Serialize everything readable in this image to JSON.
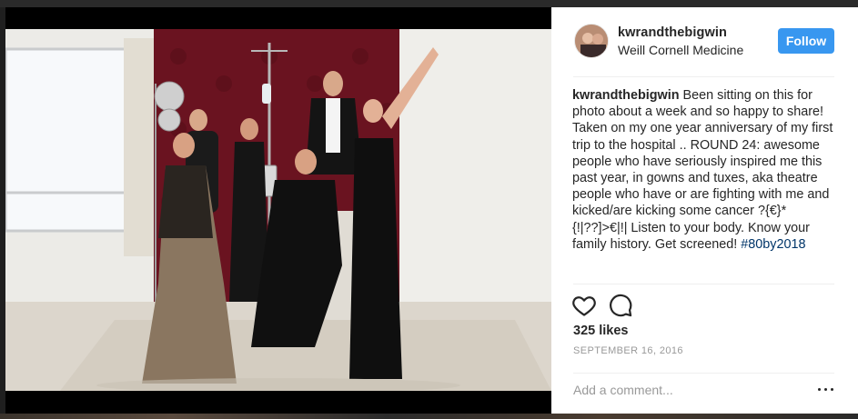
{
  "post": {
    "author": {
      "username": "kwrandthebigwin",
      "location": "Weill Cornell Medicine",
      "avatar_icon": "profile-photo-icon"
    },
    "follow_label": "Follow",
    "caption": {
      "username": "kwrandthebigwin",
      "text": " Been sitting on this for photo about a week and so happy to share! Taken on my one year anniversary of my first trip to the hospital .. ROUND 24: awesome people who have seriously inspired me this past year, in gowns and tuxes, aka theatre people who have or are fighting with me and kicked/are kicking some cancer ?{€}*{!|??]>€|!| Listen to your body. Know your family history. Get screened! ",
      "hashtag": "#80by2018"
    },
    "likes": "325 likes",
    "date": "SEPTEMBER 16, 2016",
    "comment_placeholder": "Add a comment...",
    "icons": {
      "like": "heart-icon",
      "comment": "comment-bubble-icon",
      "more": "more-options-icon"
    },
    "colors": {
      "follow_button": "#3897f0",
      "hashtag": "#003569",
      "secondary_text": "#999999"
    }
  }
}
